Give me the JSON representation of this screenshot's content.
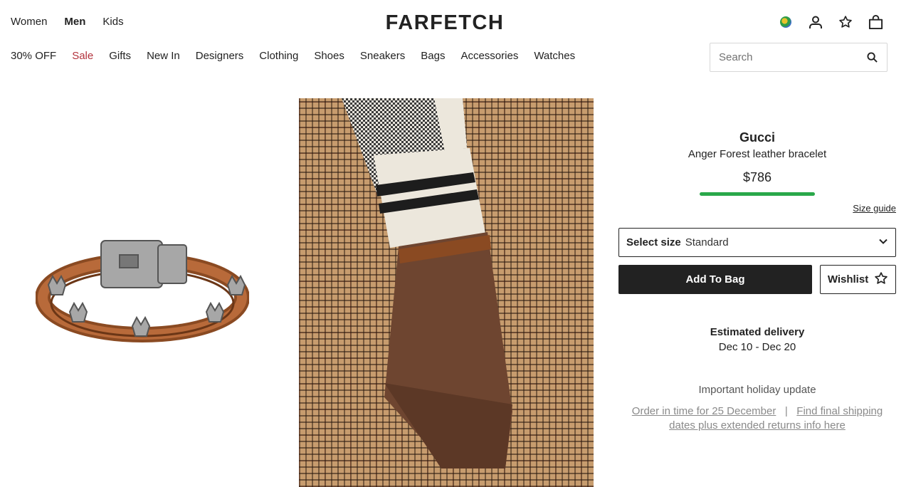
{
  "header": {
    "gender_tabs": [
      "Women",
      "Men",
      "Kids"
    ],
    "active_gender": "Men",
    "logo": "FARFETCH",
    "icons": [
      "globe-icon",
      "account-icon",
      "wishlist-star-icon",
      "shopping-bag-icon"
    ]
  },
  "categories": [
    "30% OFF",
    "Sale",
    "Gifts",
    "New In",
    "Designers",
    "Clothing",
    "Shoes",
    "Sneakers",
    "Bags",
    "Accessories",
    "Watches"
  ],
  "search": {
    "placeholder": "Search"
  },
  "product": {
    "brand": "Gucci",
    "name": "Anger Forest leather bracelet",
    "price": "$786",
    "size_guide": "Size guide",
    "select_size_label": "Select size",
    "select_size_value": "Standard",
    "add_to_bag": "Add To Bag",
    "wishlist": "Wishlist"
  },
  "delivery": {
    "title": "Estimated delivery",
    "dates": "Dec 10 - Dec 20"
  },
  "holiday": {
    "title": "Important holiday update",
    "link1": "Order in time for 25 December",
    "separator": "|",
    "link2": "Find final shipping dates plus extended returns info here"
  },
  "colors": {
    "sale": "#b3323c",
    "price_bar": "#2aa84a",
    "primary_button": "#222222"
  }
}
